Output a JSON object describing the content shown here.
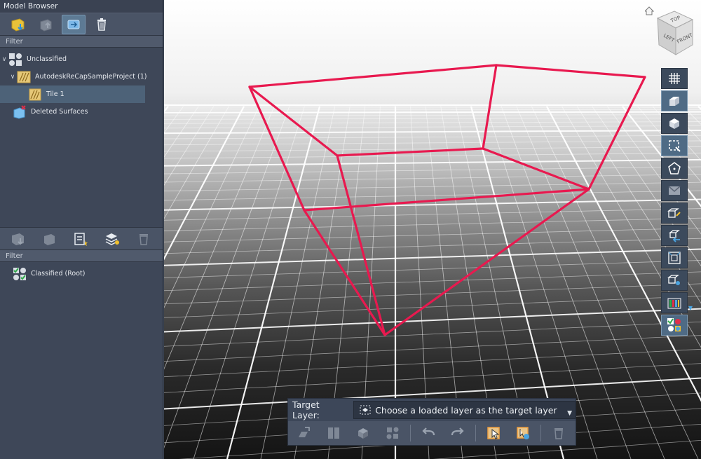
{
  "model_browser": {
    "title": "Model Browser",
    "filter_placeholder": "Filter",
    "tree": {
      "unclassified": "Unclassified",
      "project": "AutodeskReCapSampleProject (1)",
      "tile": "Tile 1",
      "deleted": "Deleted Surfaces"
    }
  },
  "classified_browser": {
    "filter_placeholder": "Filter",
    "root": "Classified (Root)"
  },
  "viewcube": {
    "top": "TOP",
    "left": "LEFT",
    "front": "FRONT"
  },
  "target_layer": {
    "label": "Target Layer:",
    "value": "Choose a loaded layer as the target layer"
  },
  "colors": {
    "selection_box": "#e8194f",
    "panel_bg": "#3e4758",
    "selected_row": "#4d6278",
    "grid_line": "#ffffff"
  }
}
